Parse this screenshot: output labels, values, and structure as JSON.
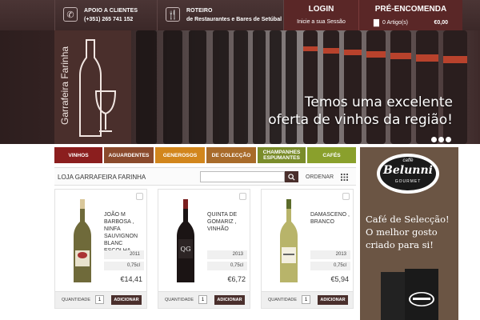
{
  "topbar": {
    "support_line1": "APOIO A CLIENTES",
    "support_line2": "(+351) 265 741 152",
    "support_icon": "phone-icon",
    "guide_line1": "ROTEIRO",
    "guide_line2": "de Restaurantes e Bares de Setúbal",
    "guide_icon": "cutlery-icon",
    "login_label": "LOGIN",
    "login_sub": "Inicie a sua Sessão",
    "preorder_label": "PRÉ-ENCOMENDA",
    "cart_items": "0 Artigo(s)",
    "cart_total": "€0,00"
  },
  "hero": {
    "brand": "Garrafeira Farinha",
    "caption_line1": "Temos uma excelente",
    "caption_line2": "oferta de vinhos da região!"
  },
  "categories": [
    {
      "label": "VINHOS",
      "color": "#8b1e1e"
    },
    {
      "label": "AGUARDENTES",
      "color": "#8a4a2c"
    },
    {
      "label": "GENEROSOS",
      "color": "#d2861c"
    },
    {
      "label": "DE COLECÇÃO",
      "color": "#a86b2a"
    },
    {
      "label": "CHAMPANHES ESPUMANTES",
      "color": "#7a8c2a"
    },
    {
      "label": "CAFÉS",
      "color": "#8aa02c"
    }
  ],
  "shop": {
    "title": "LOJA GARRAFEIRA FARINHA",
    "search_placeholder": "",
    "order_label": "ORDENAR"
  },
  "products": [
    {
      "name": "JOÃO M BARBOSA , NINFA SAUVIGNON BLANC ESCOLHA",
      "year": "2011",
      "volume": "0,75cl",
      "price": "€14,41",
      "qty_label": "QUANTIDADE",
      "qty": "1",
      "add_label": "ADICIONAR"
    },
    {
      "name": "QUINTA DE GOMARIZ , VINHÃO",
      "year": "2013",
      "volume": "0,75cl",
      "price": "€6,72",
      "qty_label": "QUANTIDADE",
      "qty": "1",
      "add_label": "ADICIONAR"
    },
    {
      "name": "DAMASCENO , BRANCO",
      "year": "2013",
      "volume": "0,75cl",
      "price": "€5,94",
      "qty_label": "QUANTIDADE",
      "qty": "1",
      "add_label": "ADICIONAR"
    }
  ],
  "ad": {
    "caffe": "caffè",
    "brand": "Belunni",
    "gourmet": "GOURMET",
    "line1": "Café de Selecção!",
    "line2": "O melhor gosto",
    "line3": "criado para si!"
  }
}
